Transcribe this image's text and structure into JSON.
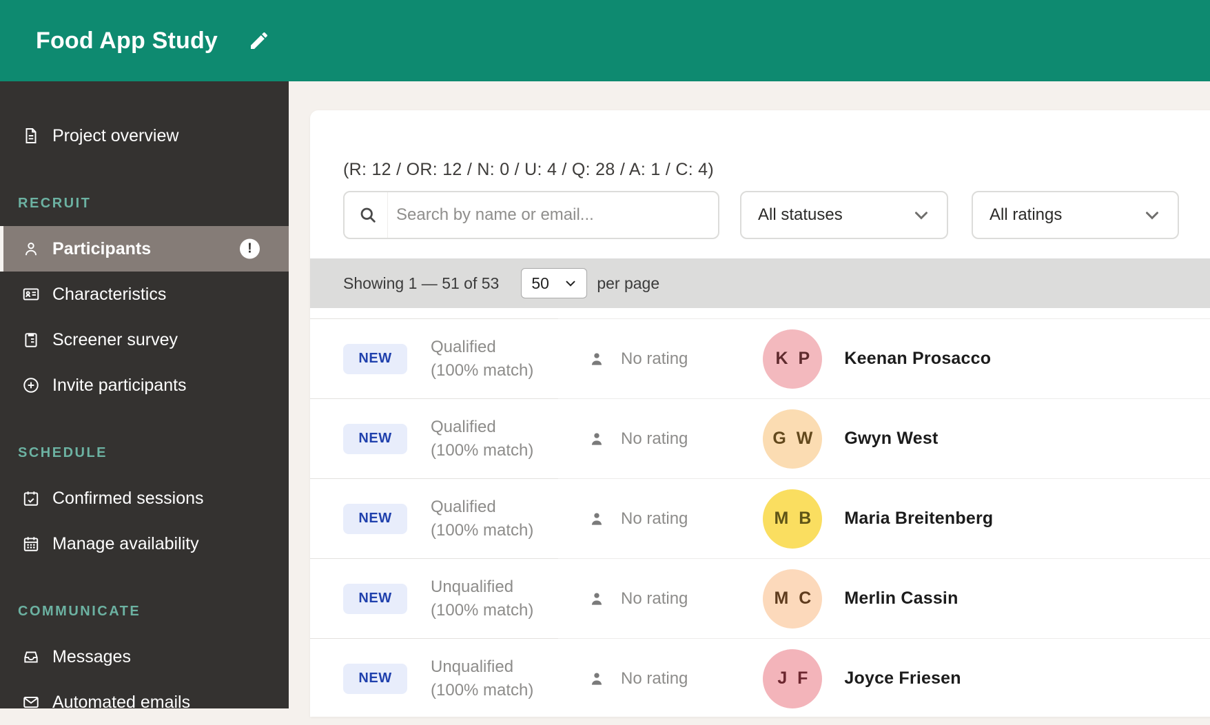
{
  "header": {
    "title": "Food App Study"
  },
  "sidebar": {
    "sections": [
      {
        "items": [
          {
            "label": "Project overview",
            "icon": "document-icon"
          }
        ]
      },
      {
        "label": "RECRUIT",
        "items": [
          {
            "label": "Participants",
            "icon": "person-icon",
            "selected": true,
            "alert": "!"
          },
          {
            "label": "Characteristics",
            "icon": "id-card-icon"
          },
          {
            "label": "Screener survey",
            "icon": "clipboard-icon"
          },
          {
            "label": "Invite participants",
            "icon": "plus-circle-icon"
          }
        ]
      },
      {
        "label": "SCHEDULE",
        "items": [
          {
            "label": "Confirmed sessions",
            "icon": "calendar-check-icon"
          },
          {
            "label": "Manage availability",
            "icon": "calendar-grid-icon"
          }
        ]
      },
      {
        "label": "COMMUNICATE",
        "items": [
          {
            "label": "Messages",
            "icon": "inbox-icon"
          },
          {
            "label": "Automated emails",
            "icon": "envelope-icon"
          }
        ]
      }
    ]
  },
  "main": {
    "stats_line": "(R: 12 / OR: 12 / N: 0 / U: 4 / Q: 28 / A: 1 / C: 4)",
    "search": {
      "placeholder": "Search by name or email..."
    },
    "filters": {
      "statuses": "All statuses",
      "ratings": "All ratings"
    },
    "pagination": {
      "showing": "Showing 1 — 51 of 53",
      "per_page": "50",
      "suffix": "per page"
    },
    "participants": [
      {
        "badge": "NEW",
        "status": "Qualified",
        "match": "(100% match)",
        "rating": "No rating",
        "initials": "K P",
        "name": "Keenan Prosacco",
        "avatar_style": "background:#f3b9be;color:#5f2b2e"
      },
      {
        "badge": "NEW",
        "status": "Qualified",
        "match": "(100% match)",
        "rating": "No rating",
        "initials": "G W",
        "name": "Gwyn West",
        "avatar_style": "background:#fbdcb2;color:#63491d"
      },
      {
        "badge": "NEW",
        "status": "Qualified",
        "match": "(100% match)",
        "rating": "No rating",
        "initials": "M B",
        "name": "Maria Breitenberg",
        "avatar_style": "background:#fade60;color:#5f5416"
      },
      {
        "badge": "NEW",
        "status": "Unqualified",
        "match": "(100% match)",
        "rating": "No rating",
        "initials": "M C",
        "name": "Merlin Cassin",
        "avatar_style": "background:#fcd9bb;color:#5f3c1e"
      },
      {
        "badge": "NEW",
        "status": "Unqualified",
        "match": "(100% match)",
        "rating": "No rating",
        "initials": "J F",
        "name": "Joyce Friesen",
        "avatar_style": "background:#f3b4ba;color:#6d2730"
      }
    ]
  },
  "colors": {
    "header_green": "#0e8a70",
    "sidebar_bg": "#343230",
    "sidebar_selected": "#857c77",
    "section_label": "#6cb2a2",
    "content_bg": "#f5f1ed",
    "pagination_bar": "#dcdcdb",
    "badge_bg": "#e8edfb",
    "badge_text": "#2041ad"
  }
}
